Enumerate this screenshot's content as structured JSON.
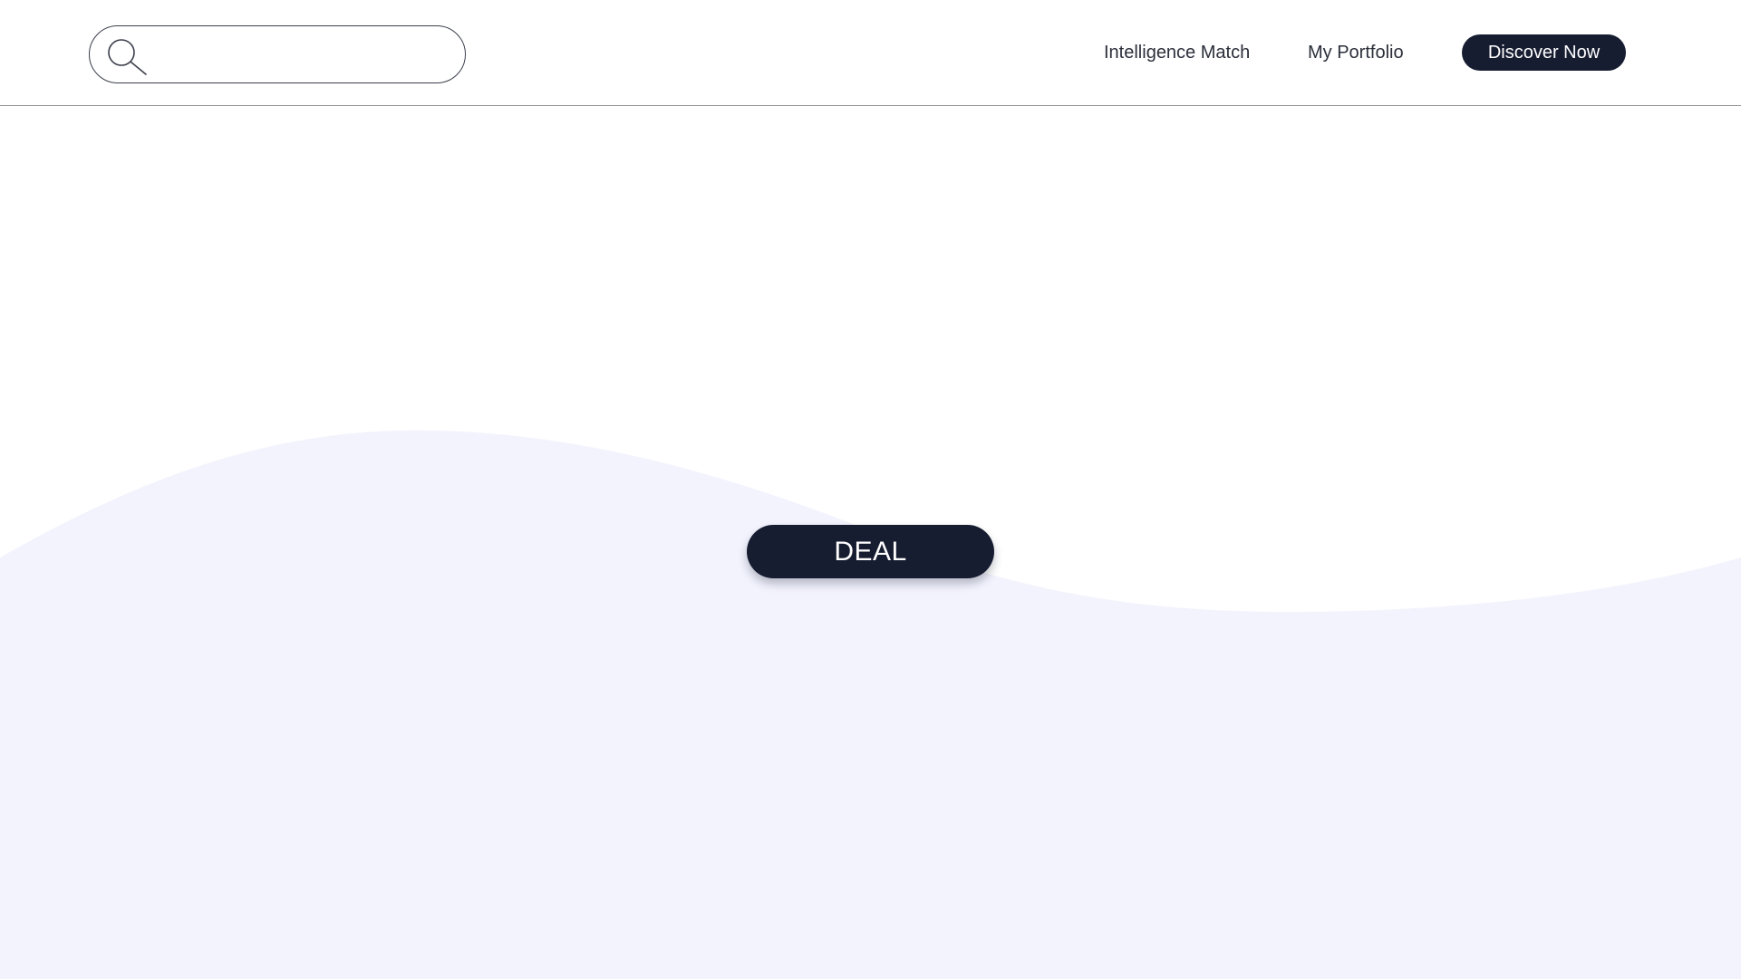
{
  "header": {
    "search": {
      "placeholder": "",
      "value": "",
      "icon": "search-icon"
    },
    "nav": {
      "intelligence_match": "Intelligence Match",
      "my_portfolio": "My Portfolio",
      "discover_now": "Discover Now"
    }
  },
  "hero": {
    "deal_label": "DEAL"
  },
  "colors": {
    "primary_dark": "#171d31",
    "wave_fill": "#f2f3fd",
    "background": "#ffffff",
    "header_border": "#8f8f8f"
  }
}
